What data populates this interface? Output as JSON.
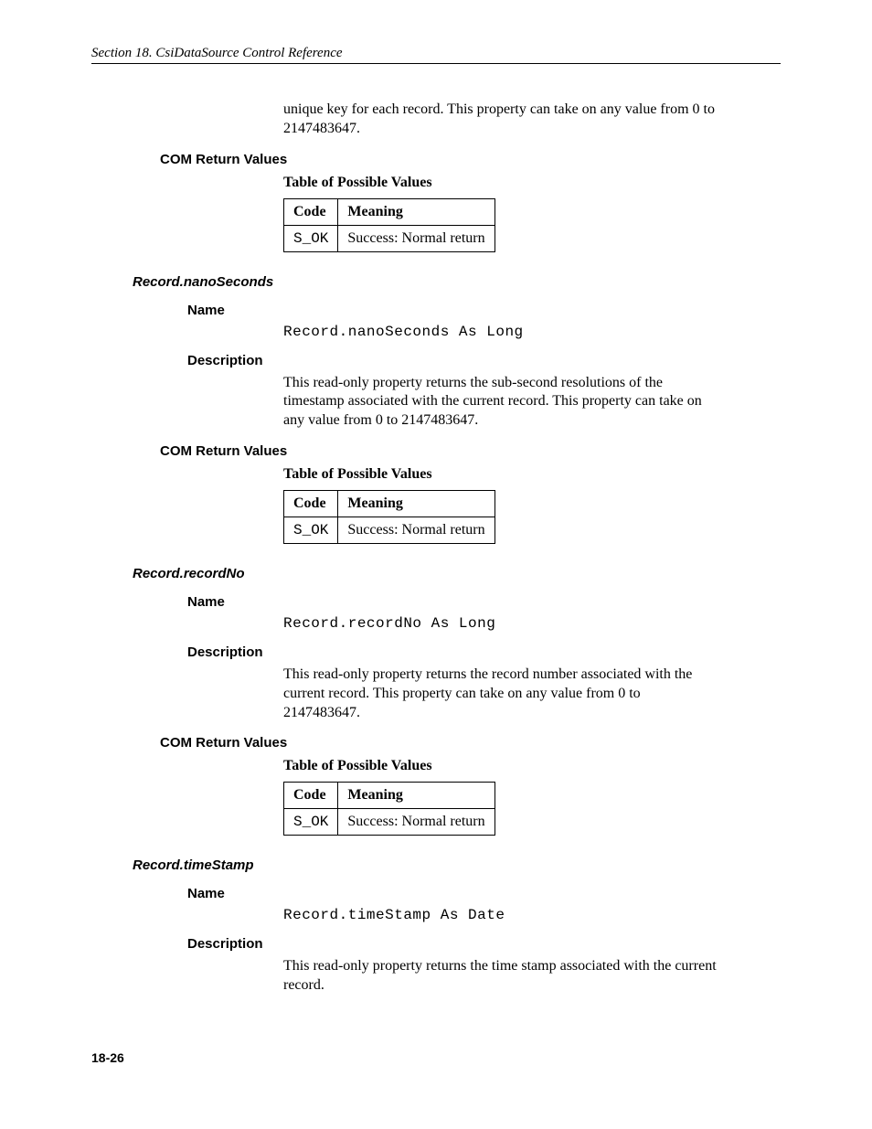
{
  "header": "Section 18.  CsiDataSource Control Reference",
  "intro_paragraph": "unique key for each record.  This property can take on any value from 0 to 2147483647.",
  "labels": {
    "com_return_values": "COM Return Values",
    "table_caption": "Table of Possible Values",
    "code": "Code",
    "meaning": "Meaning",
    "name": "Name",
    "description": "Description"
  },
  "table_row": {
    "code": "S_OK",
    "meaning": "Success: Normal return"
  },
  "sections": {
    "nanoSeconds": {
      "title": "Record.nanoSeconds",
      "signature": "Record.nanoSeconds As Long",
      "description": "This read-only property returns the sub-second resolutions of the timestamp associated with the current record.  This property can take on any value from 0 to 2147483647."
    },
    "recordNo": {
      "title": "Record.recordNo",
      "signature": "Record.recordNo As Long",
      "description": "This read-only property returns the record number associated with the current record.  This property can take on any value from 0 to 2147483647."
    },
    "timeStamp": {
      "title": "Record.timeStamp",
      "signature": "Record.timeStamp As Date",
      "description": "This read-only property returns the time stamp associated with the current record."
    }
  },
  "page_number": "18-26"
}
